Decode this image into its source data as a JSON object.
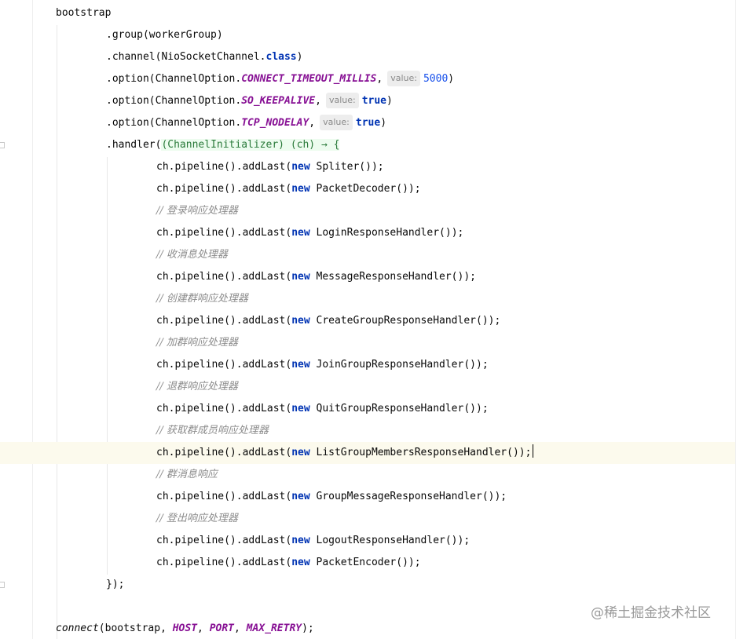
{
  "code": {
    "bootstrap": "bootstrap",
    "group": ".group(workerGroup)",
    "channel_prefix": ".channel(NioSocketChannel.",
    "class_kw": "class",
    "close_paren": ")",
    "option_prefix": ".option(ChannelOption.",
    "connect_timeout": "CONNECT_TIMEOUT_MILLIS",
    "so_keepalive": "SO_KEEPALIVE",
    "tcp_nodelay": "TCP_NODELAY",
    "comma": ",",
    "hint_value": "value:",
    "timeout_value": "5000",
    "true_kw": "true",
    "handler_prefix": ".handler(",
    "lambda_text": "(ChannelInitializer) (ch) → {",
    "pipeline_prefix": "ch.pipeline().addLast(",
    "new_kw": "new",
    "semicolon": ");",
    "closing_brace": "});",
    "connect_fn": "connect",
    "connect_args_start": "(bootstrap, ",
    "host": "HOST",
    "port": "PORT",
    "max_retry": "MAX_RETRY",
    "arg_sep": ", ",
    "connect_end": ");",
    "handlers": [
      "Spliter()",
      "PacketDecoder()",
      "LoginResponseHandler()",
      "MessageResponseHandler()",
      "CreateGroupResponseHandler()",
      "JoinGroupResponseHandler()",
      "QuitGroupResponseHandler()",
      "ListGroupMembersResponseHandler()",
      "GroupMessageResponseHandler()",
      "LogoutResponseHandler()",
      "PacketEncoder()"
    ],
    "comments": [
      "// 登录响应处理器",
      "// 收消息处理器",
      "// 创建群响应处理器",
      "// 加群响应处理器",
      "// 退群响应处理器",
      "// 获取群成员响应处理器",
      "// 群消息响应",
      "// 登出响应处理器"
    ]
  },
  "watermark": "@稀土掘金技术社区",
  "colors": {
    "keyword": "#0033b3",
    "constant": "#871094",
    "number": "#1750eb",
    "comment": "#8c8c8c",
    "caret_line": "#fcfaed",
    "lambda_highlight": "#edfcef"
  }
}
